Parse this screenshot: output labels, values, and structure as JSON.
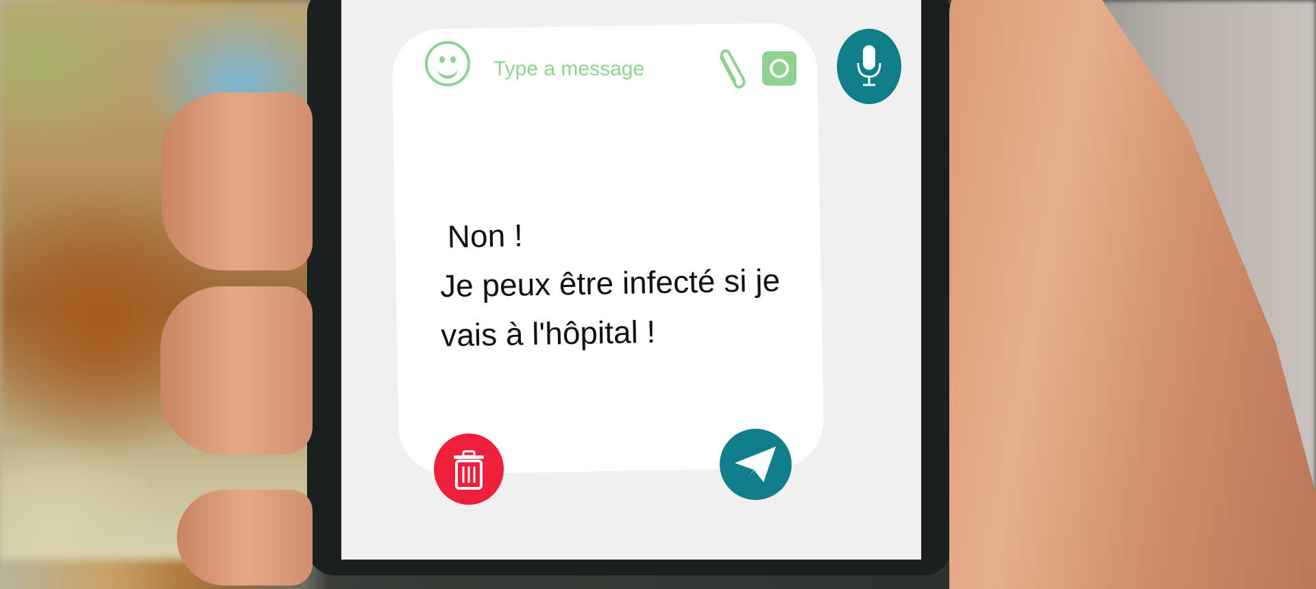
{
  "composer": {
    "placeholder": "Type a message",
    "message_lines": [
      " Non !",
      "Je peux être infecté si je",
      "vais à l'hôpital !"
    ]
  },
  "icons": {
    "emoji": "smiley-icon",
    "attach": "paperclip-icon",
    "camera": "camera-icon",
    "mic": "microphone-icon",
    "delete": "trash-icon",
    "send": "paper-plane-icon"
  },
  "colors": {
    "accent_green": "#8fd18f",
    "teal": "#107e8a",
    "delete_red": "#ee1f3a",
    "card": "#ffffff",
    "screen": "#f0f0f0"
  }
}
